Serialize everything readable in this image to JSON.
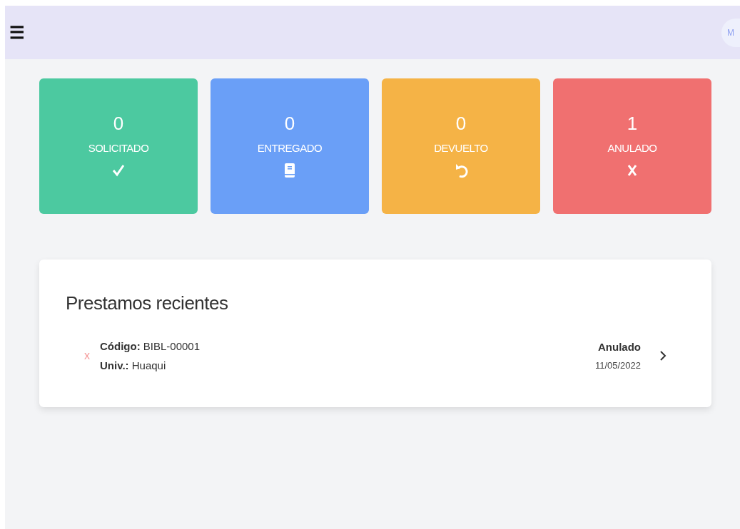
{
  "header": {
    "menu_icon": "☰",
    "avatar": "M"
  },
  "stats": [
    {
      "count": "0",
      "label": "SOLICITADO",
      "color": "#4cc9a0",
      "kind": "check"
    },
    {
      "count": "0",
      "label": "ENTREGADO",
      "color": "#6a9ff7",
      "kind": "book"
    },
    {
      "count": "0",
      "label": "DEVUELTO",
      "color": "#f5b346",
      "kind": "undo"
    },
    {
      "count": "1",
      "label": "ANULADO",
      "color": "#f07070",
      "kind": "cross"
    }
  ],
  "recent_loans": {
    "title": "Prestamos recientes",
    "items": [
      {
        "status_mark": "x",
        "code_label": "Código:",
        "code": "BIBL-00001",
        "univ_label": "Univ.:",
        "univ": "Huaqui",
        "status": "Anulado",
        "date": "11/05/2022"
      }
    ]
  }
}
